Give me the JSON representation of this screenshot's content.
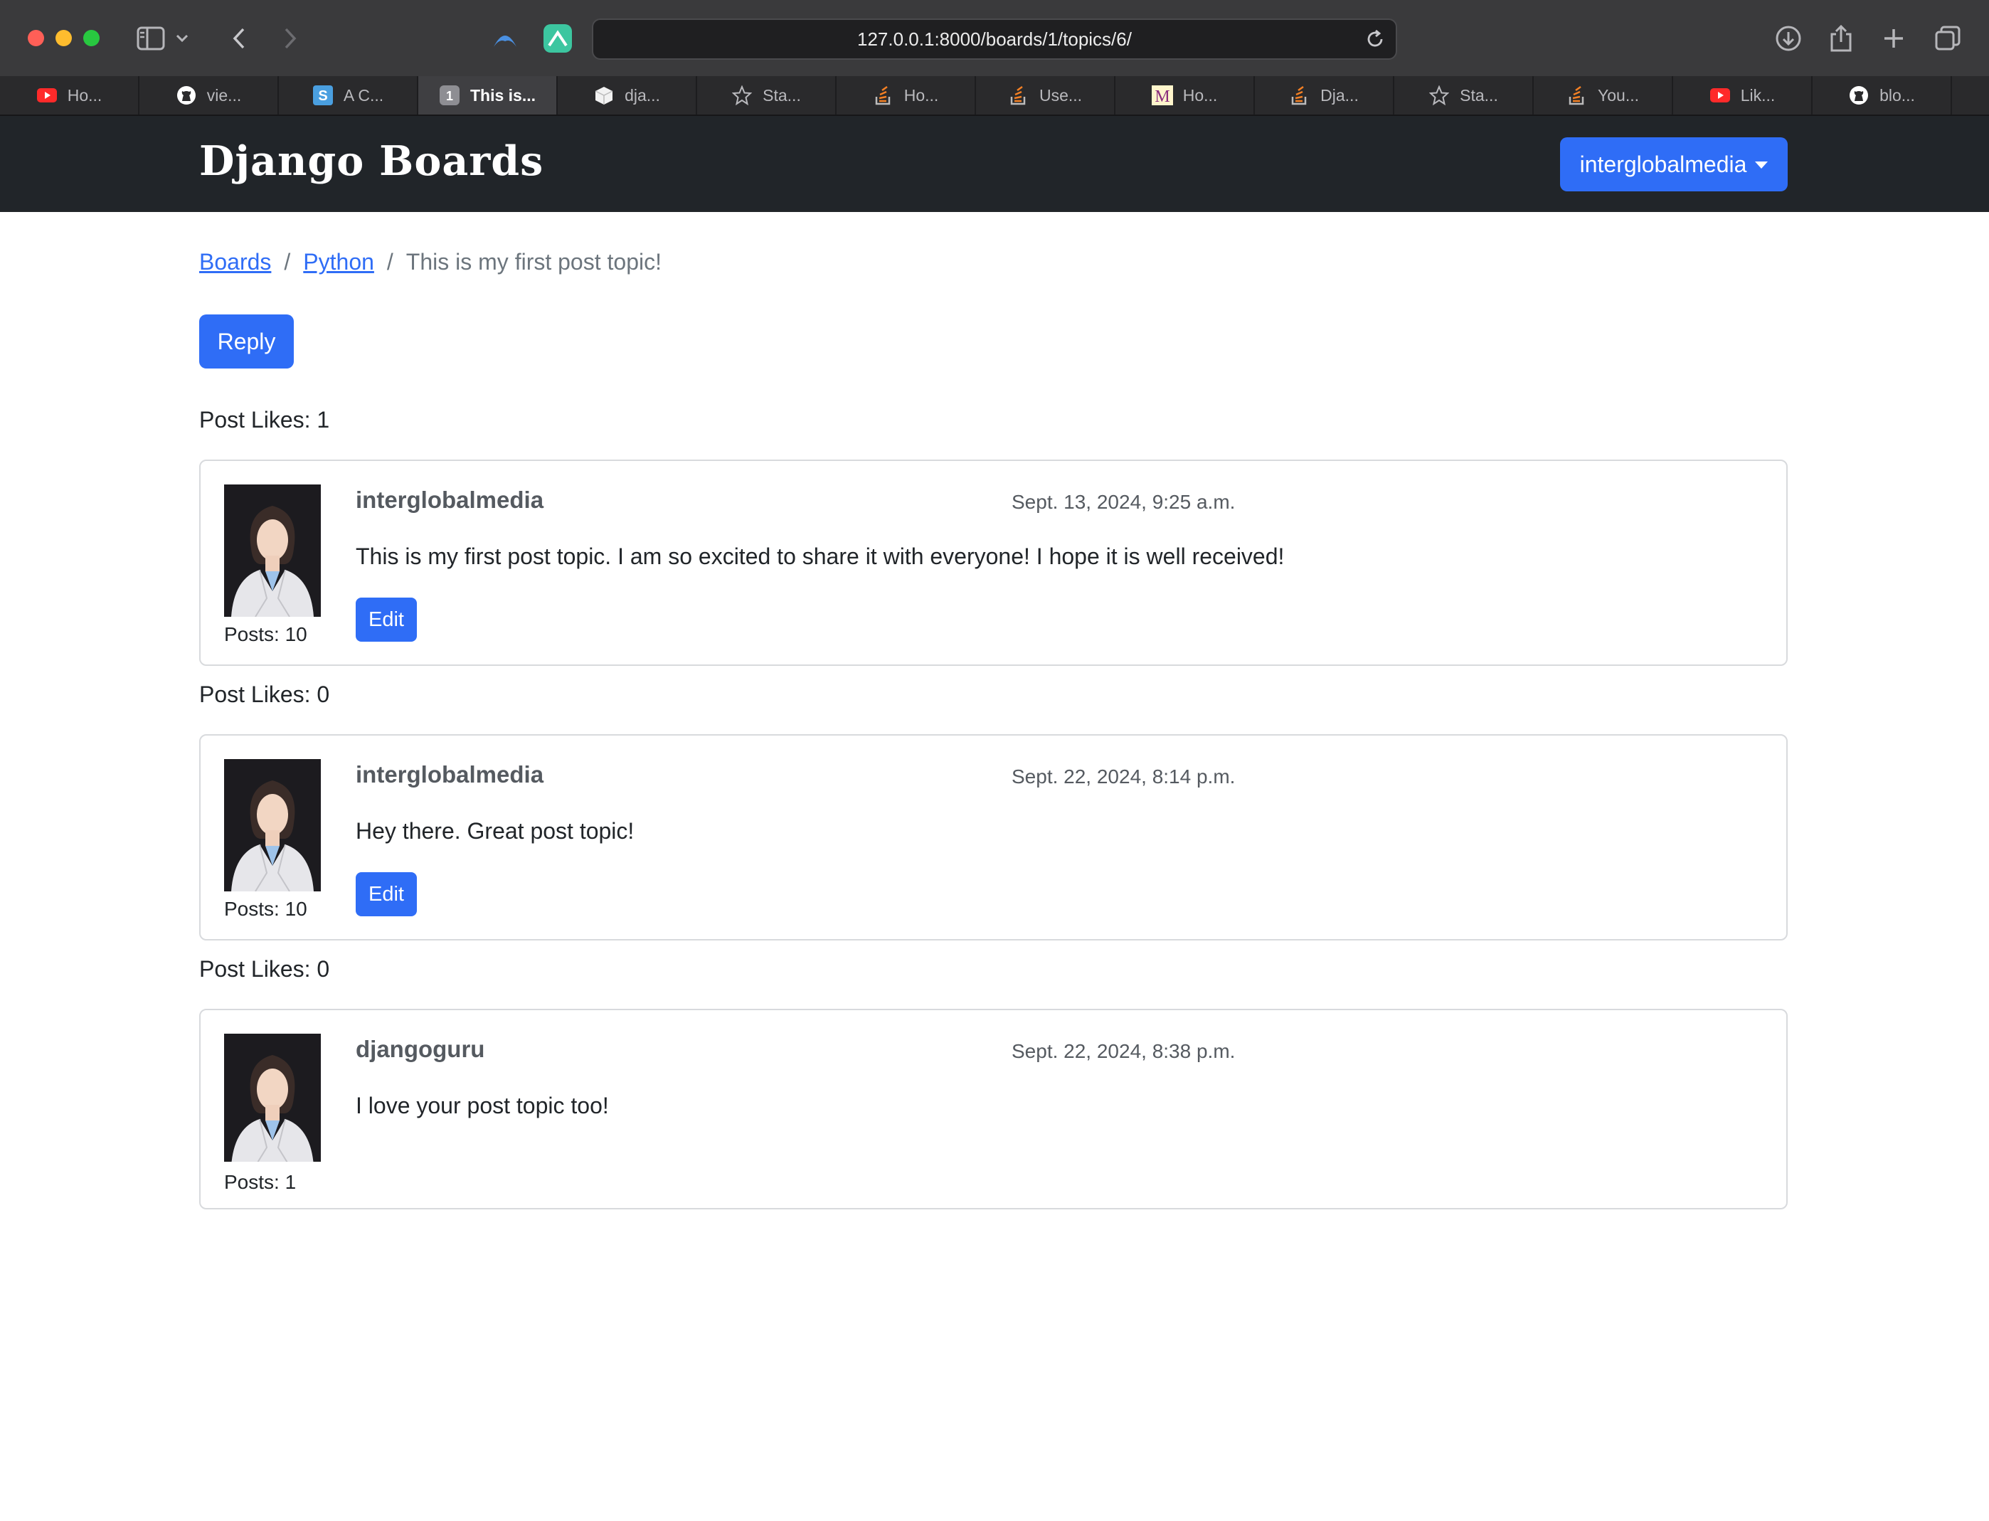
{
  "browser": {
    "url": "127.0.0.1:8000/boards/1/topics/6/",
    "tabs": [
      {
        "label": "Ho...",
        "icon": "youtube-icon",
        "active": false
      },
      {
        "label": "vie...",
        "icon": "github-icon",
        "active": false
      },
      {
        "label": "A C...",
        "icon": "s-favicon-icon",
        "active": false
      },
      {
        "label": "This is...",
        "icon": "number-one-icon",
        "active": true
      },
      {
        "label": "dja...",
        "icon": "cube-icon",
        "active": false
      },
      {
        "label": "Sta...",
        "icon": "star-icon",
        "active": false
      },
      {
        "label": "Ho...",
        "icon": "stackoverflow-icon",
        "active": false
      },
      {
        "label": "Use...",
        "icon": "stackoverflow-icon",
        "active": false
      },
      {
        "label": "Ho...",
        "icon": "medium-icon",
        "active": false
      },
      {
        "label": "Dja...",
        "icon": "stackoverflow-icon",
        "active": false
      },
      {
        "label": "Sta...",
        "icon": "star-icon",
        "active": false
      },
      {
        "label": "You...",
        "icon": "stackoverflow-icon",
        "active": false
      },
      {
        "label": "Lik...",
        "icon": "youtube-icon",
        "active": false
      },
      {
        "label": "blo...",
        "icon": "github-icon",
        "active": false
      }
    ]
  },
  "navbar": {
    "brand": "Django Boards",
    "user": "interglobalmedia"
  },
  "breadcrumb": {
    "boards": "Boards",
    "board": "Python",
    "topic": "This is my first post topic!",
    "separator": "/"
  },
  "reply_label": "Reply",
  "posts": [
    {
      "likes": "Post Likes: 1",
      "author": "interglobalmedia",
      "date": "Sept. 13, 2024, 9:25 a.m.",
      "message": "This is my first post topic. I am so excited to share it with everyone! I hope it is well received!",
      "posts_count": "Posts: 10",
      "edit_label": "Edit"
    },
    {
      "likes": "Post Likes: 0",
      "author": "interglobalmedia",
      "date": "Sept. 22, 2024, 8:14 p.m.",
      "message": "Hey there. Great post topic!",
      "posts_count": "Posts: 10",
      "edit_label": "Edit"
    },
    {
      "likes": "Post Likes: 0",
      "author": "djangoguru",
      "date": "Sept. 22, 2024, 8:38 p.m.",
      "message": "I love your post topic too!",
      "posts_count": "Posts: 1"
    }
  ],
  "colors": {
    "primary": "#2f6df6",
    "navbar": "#212529",
    "chrome": "#3a3a3c"
  }
}
